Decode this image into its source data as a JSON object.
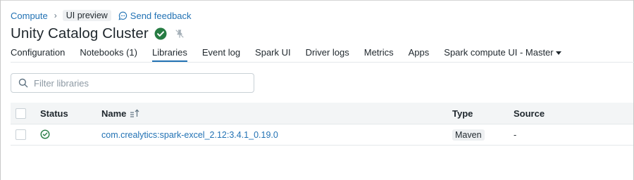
{
  "breadcrumb": {
    "parent": "Compute",
    "separator": "›",
    "badge": "UI preview",
    "feedback": "Send feedback"
  },
  "page": {
    "title": "Unity Catalog Cluster",
    "status": "running"
  },
  "tabs": [
    {
      "label": "Configuration",
      "active": false
    },
    {
      "label": "Notebooks (1)",
      "active": false
    },
    {
      "label": "Libraries",
      "active": true
    },
    {
      "label": "Event log",
      "active": false
    },
    {
      "label": "Spark UI",
      "active": false
    },
    {
      "label": "Driver logs",
      "active": false
    },
    {
      "label": "Metrics",
      "active": false
    },
    {
      "label": "Apps",
      "active": false
    },
    {
      "label": "Spark compute UI - Master",
      "active": false,
      "dropdown": true
    }
  ],
  "filter": {
    "placeholder": "Filter libraries",
    "value": ""
  },
  "table": {
    "columns": {
      "status": "Status",
      "name": "Name",
      "type": "Type",
      "source": "Source"
    },
    "rows": [
      {
        "status": "installed",
        "name": "com.crealytics:spark-excel_2.12:3.4.1_0.19.0",
        "type": "Maven",
        "source": "-"
      }
    ]
  },
  "colors": {
    "link": "#2272b4",
    "success": "#277c43",
    "active_tab_underline": "#2272b4"
  }
}
